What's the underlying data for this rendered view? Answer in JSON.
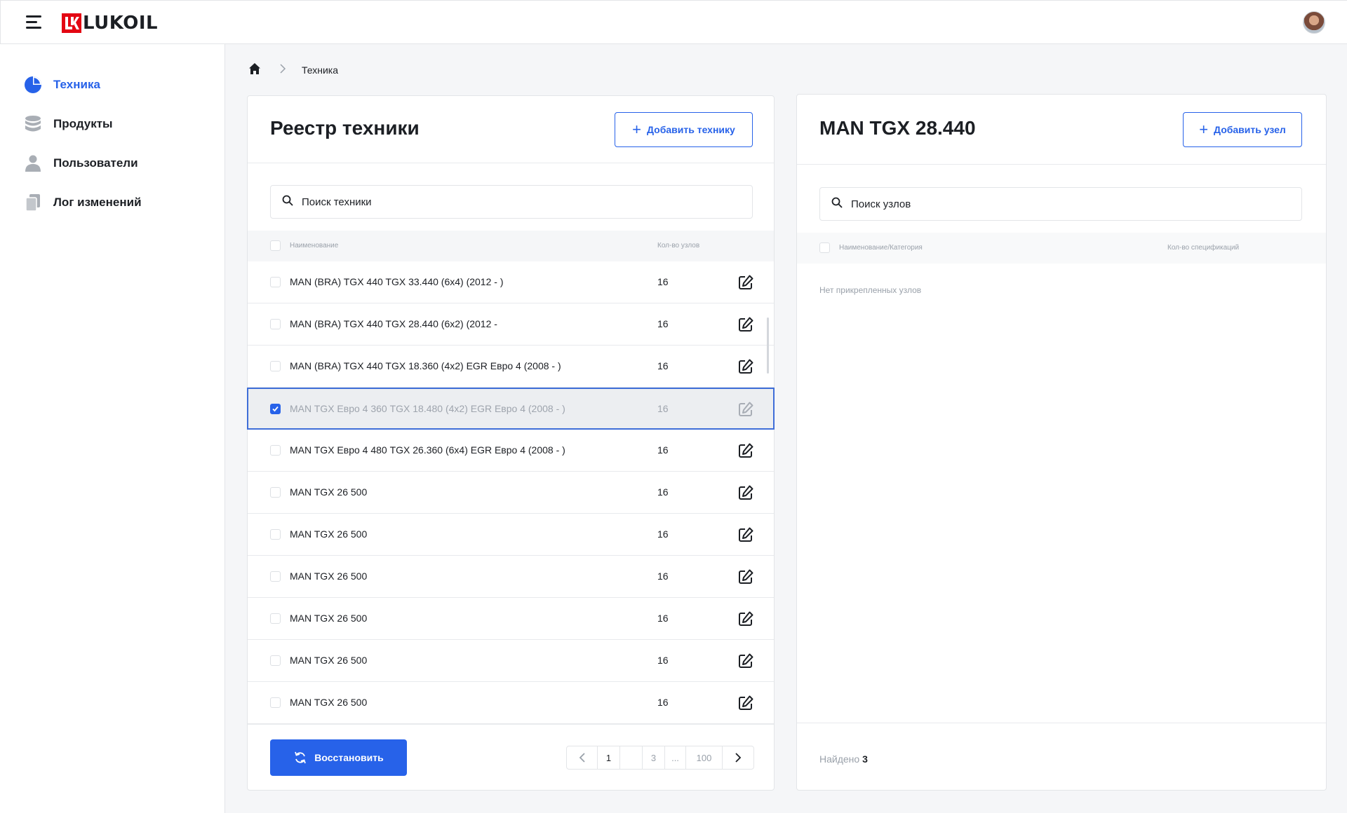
{
  "header": {
    "logo_text": "LUKOIL"
  },
  "sidebar": {
    "items": [
      {
        "label": "Техника",
        "active": true
      },
      {
        "label": "Продукты"
      },
      {
        "label": "Пользователи"
      },
      {
        "label": "Лог изменений"
      }
    ]
  },
  "breadcrumb": {
    "current": "Техника"
  },
  "left_panel": {
    "title": "Реестр техники",
    "add_button": "Добавить технику",
    "search_placeholder": "Поиск техники",
    "columns": {
      "name": "Наименование",
      "count": "Кол-во узлов"
    },
    "rows": [
      {
        "name": "MAN (BRA) TGX 440 TGX 33.440 (6x4) (2012 - )",
        "count": "16",
        "checked": false
      },
      {
        "name": "MAN (BRA) TGX 440 TGX 28.440 (6x2) (2012 -",
        "count": "16",
        "checked": false
      },
      {
        "name": "MAN (BRA) TGX 440 TGX 18.360 (4x2) EGR Евро 4 (2008 - )",
        "count": "16",
        "checked": false
      },
      {
        "name": "MAN TGX Евро 4 360 TGX 18.480 (4x2) EGR Евро 4 (2008 - )",
        "count": "16",
        "checked": true
      },
      {
        "name": "MAN TGX Евро 4 480 TGX 26.360 (6x4) EGR Евро 4 (2008 - )",
        "count": "16",
        "checked": false
      },
      {
        "name": "MAN TGX 26 500",
        "count": "16",
        "checked": false
      },
      {
        "name": "MAN TGX 26 500",
        "count": "16",
        "checked": false
      },
      {
        "name": "MAN TGX 26 500",
        "count": "16",
        "checked": false
      },
      {
        "name": "MAN TGX 26 500",
        "count": "16",
        "checked": false
      },
      {
        "name": "MAN TGX 26 500",
        "count": "16",
        "checked": false
      },
      {
        "name": "MAN TGX 26 500",
        "count": "16",
        "checked": false
      }
    ],
    "restore_button": "Восстановить",
    "pagination": {
      "pages": [
        "1",
        "",
        "3",
        "...",
        "100"
      ],
      "current": "1"
    }
  },
  "right_panel": {
    "title": "MAN TGX 28.440",
    "add_button": "Добавить узел",
    "search_placeholder": "Поиск узлов",
    "columns": {
      "name": "Наименование/Категория",
      "count": "Кол-во спецификаций"
    },
    "empty_text": "Нет прикрепленных узлов",
    "found_label": "Найдено",
    "found_count": "3"
  },
  "colors": {
    "accent": "#2762e9",
    "brand": "#e30613",
    "selected_border": "#3f6ed8"
  }
}
